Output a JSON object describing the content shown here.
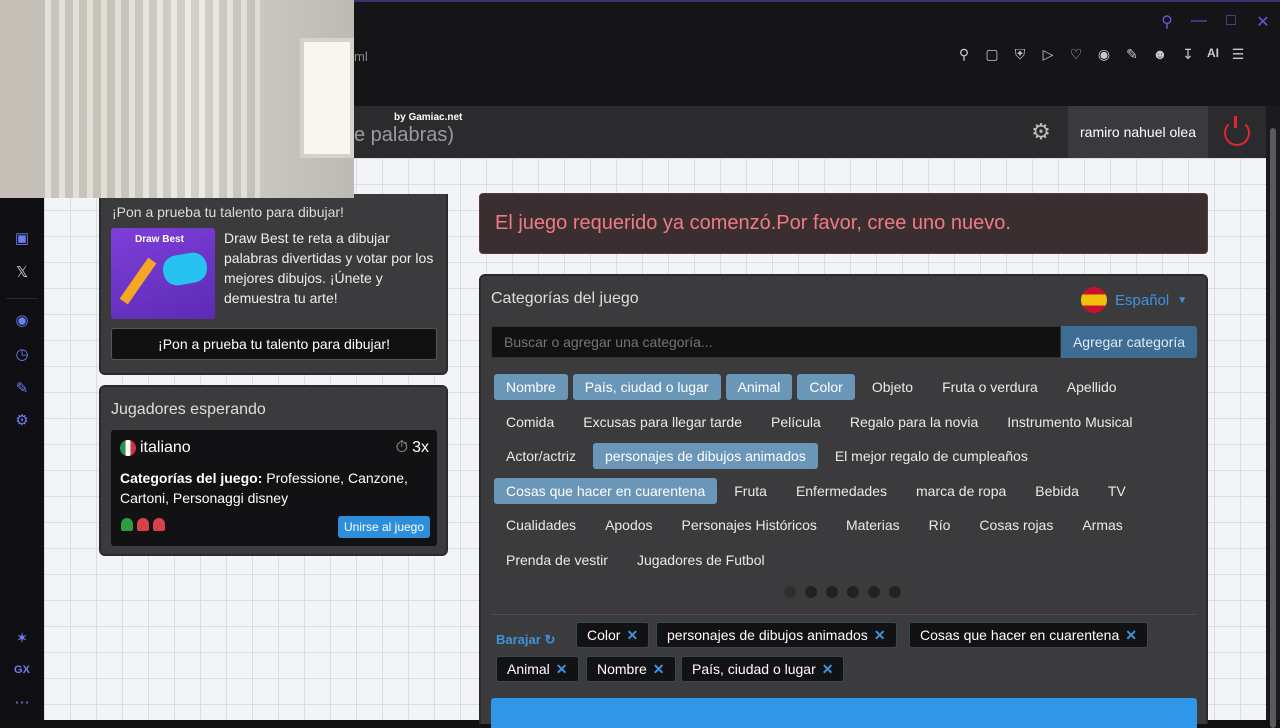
{
  "browser": {
    "url_fragment": "ml",
    "ai_label": "AI"
  },
  "navbar": {
    "title_visible": "e palabras)",
    "badge": "by Gamiac.net",
    "username": "ramiro nahuel olea"
  },
  "ad": {
    "title": "¡Pon a prueba tu talento para dibujar!",
    "image_text": "Draw Best",
    "description": "Draw Best te reta a dibujar palabras divertidas y votar por los mejores dibujos. ¡Únete y demuestra tu arte!",
    "button_label": "¡Pon a prueba tu talento para dibujar!"
  },
  "waiting": {
    "title": "Jugadores esperando",
    "room": {
      "language": "italiano",
      "multiplier": "3x",
      "categories_label": "Categorías del juego:",
      "categories_value": " Professione, Canzone, Cartoni, Personaggi disney",
      "players": [
        "#2e9c3f",
        "#d9414a",
        "#d9414a"
      ],
      "join_label": "Unirse al juego"
    }
  },
  "alert": {
    "message": "El juego requerido ya comenzó.Por favor, cree uno nuevo."
  },
  "categories": {
    "title": "Categorías del juego",
    "language": "Español",
    "search_placeholder": "Buscar o agregar una categoría...",
    "add_label": "Agregar categoría",
    "rows": [
      [
        {
          "label": "Nombre",
          "selected": true
        },
        {
          "label": "País, ciudad o lugar",
          "selected": true
        },
        {
          "label": "Animal",
          "selected": true
        },
        {
          "label": "Color",
          "selected": true
        },
        {
          "label": "Objeto",
          "selected": false
        },
        {
          "label": "Fruta o verdura",
          "selected": false
        },
        {
          "label": "Apellido",
          "selected": false
        }
      ],
      [
        {
          "label": "Comida",
          "selected": false
        },
        {
          "label": "Excusas para llegar tarde",
          "selected": false
        },
        {
          "label": "Película",
          "selected": false
        },
        {
          "label": "Regalo para la novia",
          "selected": false
        },
        {
          "label": "Instrumento Musical",
          "selected": false
        }
      ],
      [
        {
          "label": "Actor/actriz",
          "selected": false
        },
        {
          "label": "personajes de dibujos animados",
          "selected": true
        },
        {
          "label": "El mejor regalo de cumpleaños",
          "selected": false
        }
      ],
      [
        {
          "label": "Cosas que hacer en cuarentena",
          "selected": true
        },
        {
          "label": "Fruta",
          "selected": false
        },
        {
          "label": "Enfermedades",
          "selected": false
        },
        {
          "label": "marca de ropa",
          "selected": false
        },
        {
          "label": "Bebida",
          "selected": false
        },
        {
          "label": "TV",
          "selected": false
        }
      ],
      [
        {
          "label": "Cualidades",
          "selected": false
        },
        {
          "label": "Apodos",
          "selected": false
        },
        {
          "label": "Personajes Históricos",
          "selected": false
        },
        {
          "label": "Materias",
          "selected": false
        },
        {
          "label": "Río",
          "selected": false
        },
        {
          "label": "Cosas rojas",
          "selected": false
        },
        {
          "label": "Armas",
          "selected": false
        }
      ],
      [
        {
          "label": "Prenda de vestir",
          "selected": false
        },
        {
          "label": "Jugadores de Futbol",
          "selected": false
        }
      ]
    ],
    "pages": 6,
    "shuffle_label": "Barajar",
    "selected_tags": [
      "Color",
      "personajes de dibujos animados",
      "Cosas que hacer en cuarentena",
      "Animal",
      "Nombre",
      "País, ciudad o lugar"
    ]
  }
}
